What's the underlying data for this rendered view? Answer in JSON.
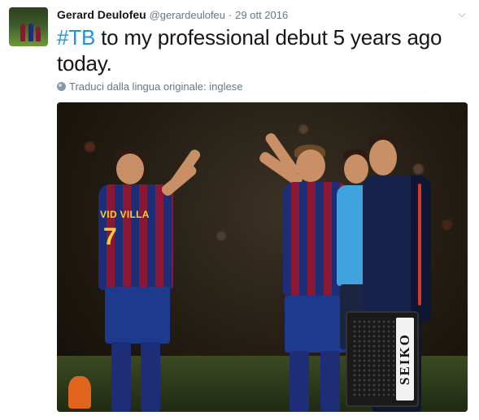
{
  "user": {
    "name": "Gerard Deulofeu",
    "handle": "@gerardeulofeu",
    "separator": "·",
    "timestamp": "29 ott 2016"
  },
  "tweet": {
    "hashtag": "#TB",
    "text": " to my professional debut 5 years ago today."
  },
  "translate": {
    "label": "Traduci dalla lingua originale: inglese",
    "icon": "globe-icon"
  },
  "menu": {
    "icon": "chevron-down-icon",
    "glyph": "⌵"
  },
  "photo": {
    "jersey_name": "VID VILLA",
    "jersey_number": "7",
    "board_brand": "SEIKO"
  },
  "colors": {
    "hashtag": "#1b95e0",
    "secondary_text": "#657786",
    "barca_blue": "#1d2d78",
    "barca_red": "#8a1733",
    "referee_blue": "#3fa3de"
  }
}
